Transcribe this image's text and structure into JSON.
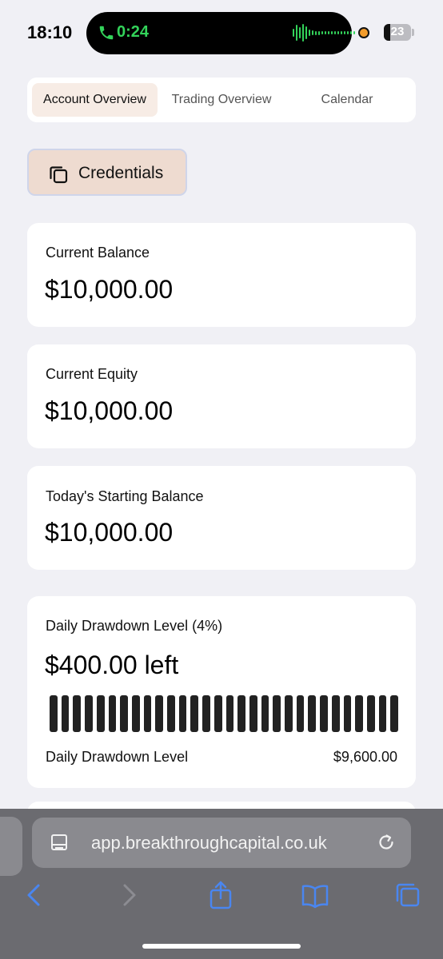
{
  "status_bar": {
    "time": "18:10",
    "call_duration": "0:24",
    "battery_percent": "23",
    "battery_level": 0.23,
    "call_color": "#33d35a",
    "recording_dot_color": "#f39c2b"
  },
  "tabs": [
    {
      "label": "Account Overview",
      "active": true
    },
    {
      "label": "Trading Overview",
      "active": false
    },
    {
      "label": "Calendar",
      "active": false
    }
  ],
  "credentials_button": {
    "label": "Credentials",
    "icon": "copy-icon"
  },
  "cards": {
    "current_balance": {
      "label": "Current Balance",
      "value": "$10,000.00"
    },
    "current_equity": {
      "label": "Current Equity",
      "value": "$10,000.00"
    },
    "starting_balance": {
      "label": "Today's Starting Balance",
      "value": "$10,000.00"
    },
    "daily_drawdown": {
      "label": "Daily Drawdown Level (4%)",
      "value": "$400.00 left",
      "progress_remaining": 1.0,
      "footer_label": "Daily Drawdown Level",
      "footer_value": "$9,600.00"
    }
  },
  "browser": {
    "url": "app.breakthroughcapital.co.uk",
    "icons": [
      "reader-icon",
      "reload-icon",
      "back-icon",
      "forward-icon",
      "share-icon",
      "bookmarks-icon",
      "tabs-icon"
    ],
    "accent_color": "#4a86f0"
  }
}
